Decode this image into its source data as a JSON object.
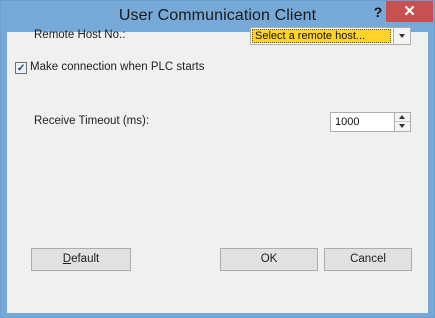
{
  "window": {
    "title": "User Communication Client",
    "help_glyph": "?",
    "close_glyph": "✕"
  },
  "form": {
    "remote_host_label": "Remote Host No.:",
    "remote_host_value": "Select a remote host...",
    "make_connection_label": "Make connection when PLC starts",
    "make_connection_checked": true,
    "receive_timeout_label": "Receive Timeout (ms):",
    "receive_timeout_value": "1000"
  },
  "buttons": {
    "default_mnemonic": "D",
    "default_rest": "efault",
    "ok_label": "OK",
    "cancel_label": "Cancel"
  },
  "icons": {
    "help": "help-icon",
    "close": "close-icon",
    "checkmark": "checkmark-icon",
    "dropdown": "chevron-down-icon",
    "spin_up": "spin-up-icon",
    "spin_down": "spin-down-icon"
  },
  "colors": {
    "titlebar": "#76a8d8",
    "close_button": "#c75050",
    "dialog_body": "#f0f0f0",
    "combo_highlight": "#ffd42a"
  }
}
